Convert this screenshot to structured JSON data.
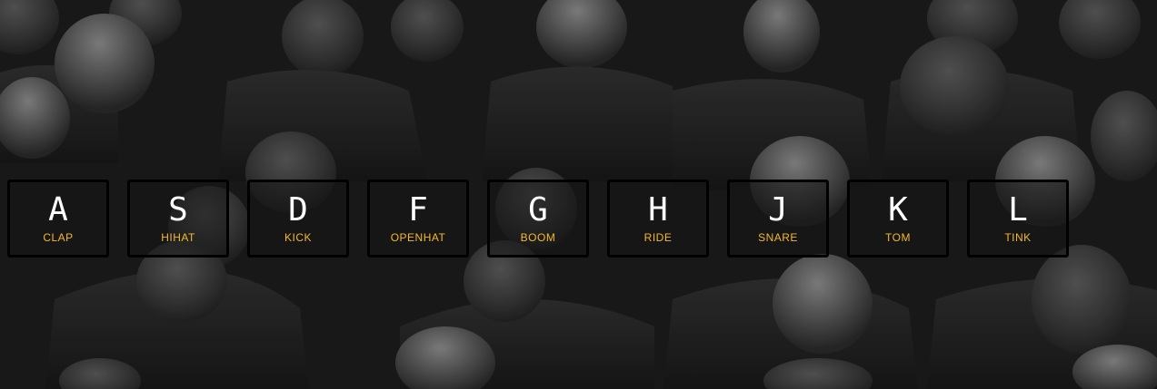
{
  "background": {
    "subject": "audience-crowd-photo",
    "tone": "black-and-white"
  },
  "accent_color": "#f5b82e",
  "keys": [
    {
      "letter": "A",
      "sound": "CLAP"
    },
    {
      "letter": "S",
      "sound": "HIHAT"
    },
    {
      "letter": "D",
      "sound": "KICK"
    },
    {
      "letter": "F",
      "sound": "OPENHAT"
    },
    {
      "letter": "G",
      "sound": "BOOM"
    },
    {
      "letter": "H",
      "sound": "RIDE"
    },
    {
      "letter": "J",
      "sound": "SNARE"
    },
    {
      "letter": "K",
      "sound": "TOM"
    },
    {
      "letter": "L",
      "sound": "TINK"
    }
  ]
}
